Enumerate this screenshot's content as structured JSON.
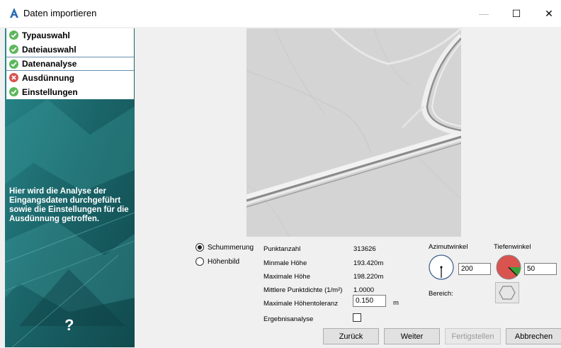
{
  "window": {
    "title": "Daten importieren",
    "minimize_glyph": "—",
    "maximize_glyph": "☐",
    "close_glyph": "✕"
  },
  "sidebar": {
    "steps": [
      {
        "label": "Typauswahl",
        "status": "ok",
        "icon": "check-circle-icon"
      },
      {
        "label": "Dateiauswahl",
        "status": "ok",
        "icon": "check-circle-icon"
      },
      {
        "label": "Datenanalyse",
        "status": "ok",
        "icon": "check-circle-icon",
        "active": true
      },
      {
        "label": "Ausdünnung",
        "status": "error",
        "icon": "error-circle-icon"
      },
      {
        "label": "Einstellungen",
        "status": "ok",
        "icon": "check-circle-icon"
      }
    ],
    "description": "Hier wird die Analyse der Eingangsdaten durchgeführt sowie die Einstellungen für die Ausdünnung getroffen.",
    "help": "?"
  },
  "view_mode": {
    "options": [
      "Schummerung",
      "Höhenbild"
    ],
    "selected": "Schummerung"
  },
  "stats": {
    "point_count_label": "Punktanzahl",
    "point_count_value": "313626",
    "min_height_label": "Minmale Höhe",
    "min_height_value": "193.420m",
    "max_height_label": "Maximale Höhe",
    "max_height_value": "198.220m",
    "density_label": "Mittlere Punktdichte (1/m²)",
    "density_value": "1.0000",
    "tolerance_label": "Maximale Höhentoleranz",
    "tolerance_value": "0.150",
    "tolerance_unit": "m",
    "result_analysis_label": "Ergebnisanalyse",
    "result_analysis_checked": false
  },
  "lighting": {
    "azimuth_label": "Azimutwinkel",
    "azimuth_value": "200",
    "depth_label": "Tiefenwinkel",
    "depth_value": "50",
    "range_label": "Bereich:"
  },
  "buttons": {
    "back": "Zurück",
    "next": "Weiter",
    "finish": "Fertigstellen",
    "cancel": "Abbrechen"
  },
  "colors": {
    "ok_green": "#5cb85c",
    "error_red": "#d9534f",
    "sidebar_teal": "#1e6b70",
    "dial_red": "#d9534f",
    "dial_green": "#3aa13a"
  }
}
